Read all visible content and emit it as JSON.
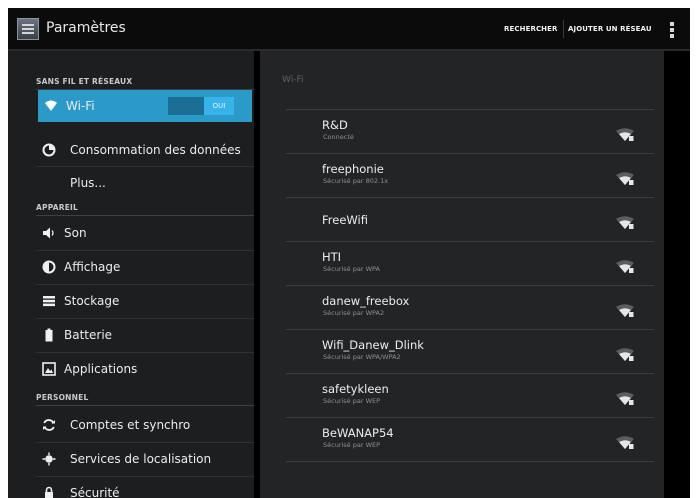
{
  "header": {
    "title": "Paramètres",
    "actions": [
      "RECHERCHER",
      "AJOUTER UN RÉSEAU"
    ]
  },
  "sidebar": {
    "sections": [
      "SANS FIL ET RÉSEAUX",
      "APPAREIL",
      "PERSONNEL"
    ],
    "items": [
      {
        "label": "Wi-Fi",
        "icon": "wifi-icon",
        "toggle": "OUI",
        "active": true
      },
      {
        "label": "Consommation des données",
        "icon": "data-usage-icon"
      },
      {
        "label": "Plus...",
        "icon": ""
      },
      {
        "label": "Son",
        "icon": "speaker-icon"
      },
      {
        "label": "Affichage",
        "icon": "display-icon"
      },
      {
        "label": "Stockage",
        "icon": "storage-icon"
      },
      {
        "label": "Batterie",
        "icon": "battery-icon"
      },
      {
        "label": "Applications",
        "icon": "apps-icon"
      },
      {
        "label": "Comptes et synchro",
        "icon": "sync-icon"
      },
      {
        "label": "Services de localisation",
        "icon": "location-icon"
      },
      {
        "label": "Sécurité",
        "icon": "lock-icon"
      }
    ]
  },
  "main": {
    "panel_title": "Wi-Fi",
    "networks": [
      {
        "ssid": "R&D",
        "status": "Connecté"
      },
      {
        "ssid": "freephonie",
        "status": "Sécurisé par 802.1x"
      },
      {
        "ssid": "FreeWifi",
        "status": ""
      },
      {
        "ssid": "HTI",
        "status": "Sécurisé par WPA"
      },
      {
        "ssid": "danew_freebox",
        "status": "Sécurisé par WPA2"
      },
      {
        "ssid": "Wifi_Danew_Dlink",
        "status": "Sécurisé par WPA/WPA2"
      },
      {
        "ssid": "safetykleen",
        "status": "Sécurisé par WEP"
      },
      {
        "ssid": "BeWANAP54",
        "status": "Sécurisé par WEP"
      }
    ]
  },
  "colors": {
    "accent": "#2b9ac9",
    "toggle_on": "#38b3ea",
    "background": "#0c0c0c",
    "sidebar": "#1d1e20",
    "panel": "#222426"
  }
}
